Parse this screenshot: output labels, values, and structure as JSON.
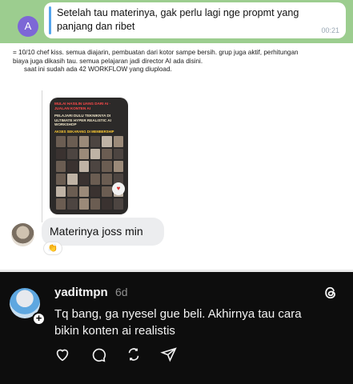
{
  "telegram": {
    "top_message": {
      "avatar_letter": "A",
      "text": "Setelah tau materinya, gak perlu lagi nge propmt yang panjang dan ribet",
      "time": "00:21"
    },
    "review_lines": [
      "= 10/10 chef kiss. semua diajarin, pembuatan dari kotor sampe bersih. grup juga aktif, perhitungan",
      "biaya juga dikasih tau. semua pelajaran jadi director AI ada disini.",
      "saat ini sudah ada 42 WORKFLOW yang diupload."
    ],
    "thumbnail": {
      "heading_red": "MULAI HASILIN UANG DARI AI · JUALAN KONTEN AI",
      "heading_main": "PELAJARI DULU TEKNIKNYA DI ULTIMATE HYPER REALISTIC AI WORKSHOP",
      "heading_yellow": "AKSES SEKARANG DI MEMBERSHIP"
    },
    "chat_message": "Materinya joss min",
    "reaction": "👏"
  },
  "threads": {
    "username": "yaditmpn",
    "time": "6d",
    "text": "Tq bang, ga nyesel gue beli. Akhirnya tau cara bikin konten ai realistis",
    "actions": [
      "heart-icon",
      "comment-icon",
      "repost-icon",
      "share-icon"
    ]
  },
  "colors": {
    "telegram_green": "#9ccd8f",
    "avatar_purple": "#7d67d6",
    "threads_bg": "#0d0d0d"
  }
}
